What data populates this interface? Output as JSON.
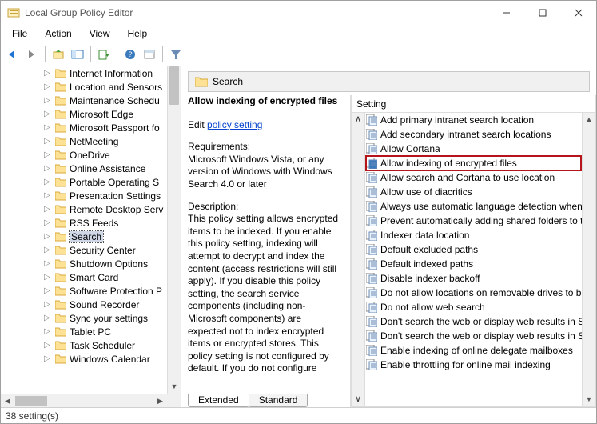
{
  "window": {
    "title": "Local Group Policy Editor"
  },
  "menu": {
    "file": "File",
    "action": "Action",
    "view": "View",
    "help": "Help"
  },
  "tree": {
    "items": [
      {
        "label": "Internet Information"
      },
      {
        "label": "Location and Sensors"
      },
      {
        "label": "Maintenance Schedu"
      },
      {
        "label": "Microsoft Edge"
      },
      {
        "label": "Microsoft Passport fo"
      },
      {
        "label": "NetMeeting"
      },
      {
        "label": "OneDrive"
      },
      {
        "label": "Online Assistance"
      },
      {
        "label": "Portable Operating S"
      },
      {
        "label": "Presentation Settings"
      },
      {
        "label": "Remote Desktop Serv"
      },
      {
        "label": "RSS Feeds"
      },
      {
        "label": "Search",
        "selected": true
      },
      {
        "label": "Security Center"
      },
      {
        "label": "Shutdown Options"
      },
      {
        "label": "Smart Card"
      },
      {
        "label": "Software Protection P"
      },
      {
        "label": "Sound Recorder"
      },
      {
        "label": "Sync your settings"
      },
      {
        "label": "Tablet PC"
      },
      {
        "label": "Task Scheduler"
      },
      {
        "label": "Windows Calendar"
      }
    ]
  },
  "detail": {
    "header": "Search",
    "policy_name": "Allow indexing of encrypted files",
    "edit_label": "Edit",
    "edit_link": "policy setting",
    "req_label": "Requirements:",
    "req_text": "Microsoft Windows Vista, or any version of Windows with Windows Search 4.0 or later",
    "desc_label": "Description:",
    "desc_text": "This policy setting allows encrypted items to be indexed. If you enable this policy setting, indexing  will attempt to decrypt and index the content (access restrictions will still apply). If you disable this policy setting, the search service components (including non-Microsoft components) are expected not to index encrypted items or encrypted stores. This policy setting is not configured by default. If you do not configure"
  },
  "settings": {
    "column_header": "Setting",
    "items": [
      {
        "label": "Add primary intranet search location"
      },
      {
        "label": "Add secondary intranet search locations"
      },
      {
        "label": "Allow Cortana"
      },
      {
        "label": "Allow indexing of encrypted files",
        "highlighted": true
      },
      {
        "label": "Allow search and Cortana to use location"
      },
      {
        "label": "Allow use of diacritics"
      },
      {
        "label": "Always use automatic language detection when in"
      },
      {
        "label": "Prevent automatically adding shared folders to th"
      },
      {
        "label": "Indexer data location"
      },
      {
        "label": "Default excluded paths"
      },
      {
        "label": "Default indexed paths"
      },
      {
        "label": "Disable indexer backoff"
      },
      {
        "label": "Do not allow locations on removable drives to be"
      },
      {
        "label": "Do not allow web search"
      },
      {
        "label": "Don't search the web or display web results in Sea"
      },
      {
        "label": "Don't search the web or display web results in Sea"
      },
      {
        "label": "Enable indexing of online delegate mailboxes"
      },
      {
        "label": "Enable throttling for online mail indexing"
      }
    ]
  },
  "tabs": {
    "extended": "Extended",
    "standard": "Standard"
  },
  "status": {
    "text": "38 setting(s)"
  }
}
